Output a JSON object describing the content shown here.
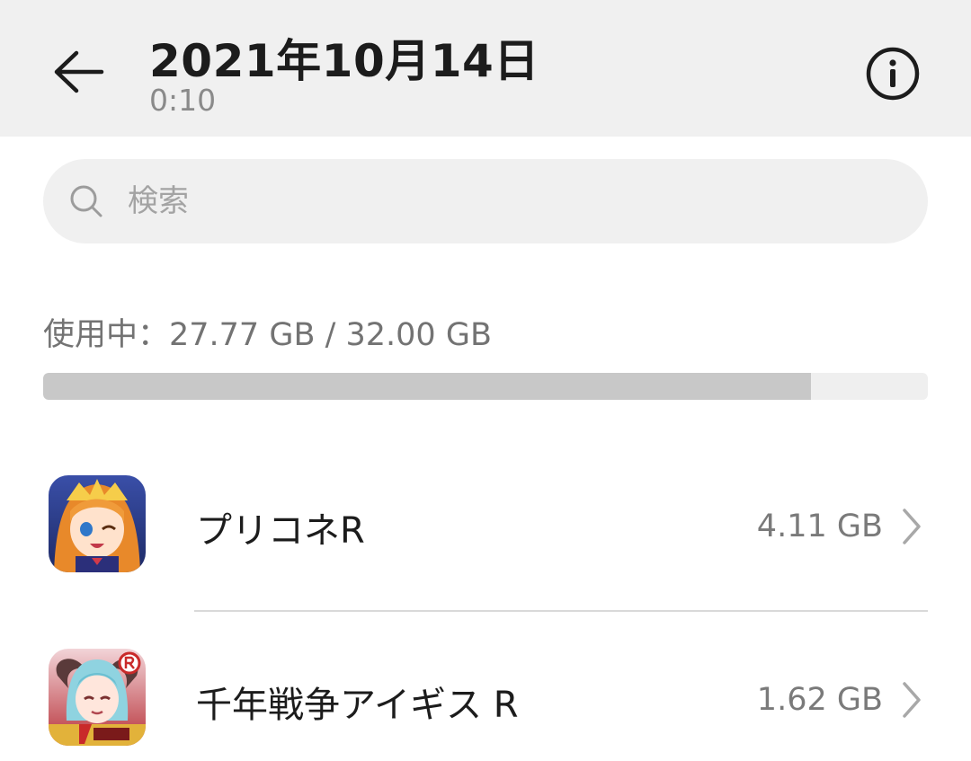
{
  "header": {
    "title": "2021年10月14日",
    "subtitle": "0:10",
    "back_icon": "arrow-left-icon",
    "info_icon": "info-circle-icon"
  },
  "search": {
    "placeholder": "検索",
    "value": "",
    "icon": "search-icon"
  },
  "storage": {
    "usage_text": "使用中：27.77 GB / 32.00 GB",
    "used_fraction": 0.868
  },
  "apps": [
    {
      "name": "プリコネR",
      "size": "4.11 GB",
      "icon": "priconne-app-icon"
    },
    {
      "name": "千年戦争アイギス R",
      "size": "1.62 GB",
      "icon": "aigis-app-icon"
    }
  ],
  "colors": {
    "header_bg": "#f0f0f0",
    "bar_fill": "#c8c8c8",
    "bar_track": "#efefef"
  }
}
